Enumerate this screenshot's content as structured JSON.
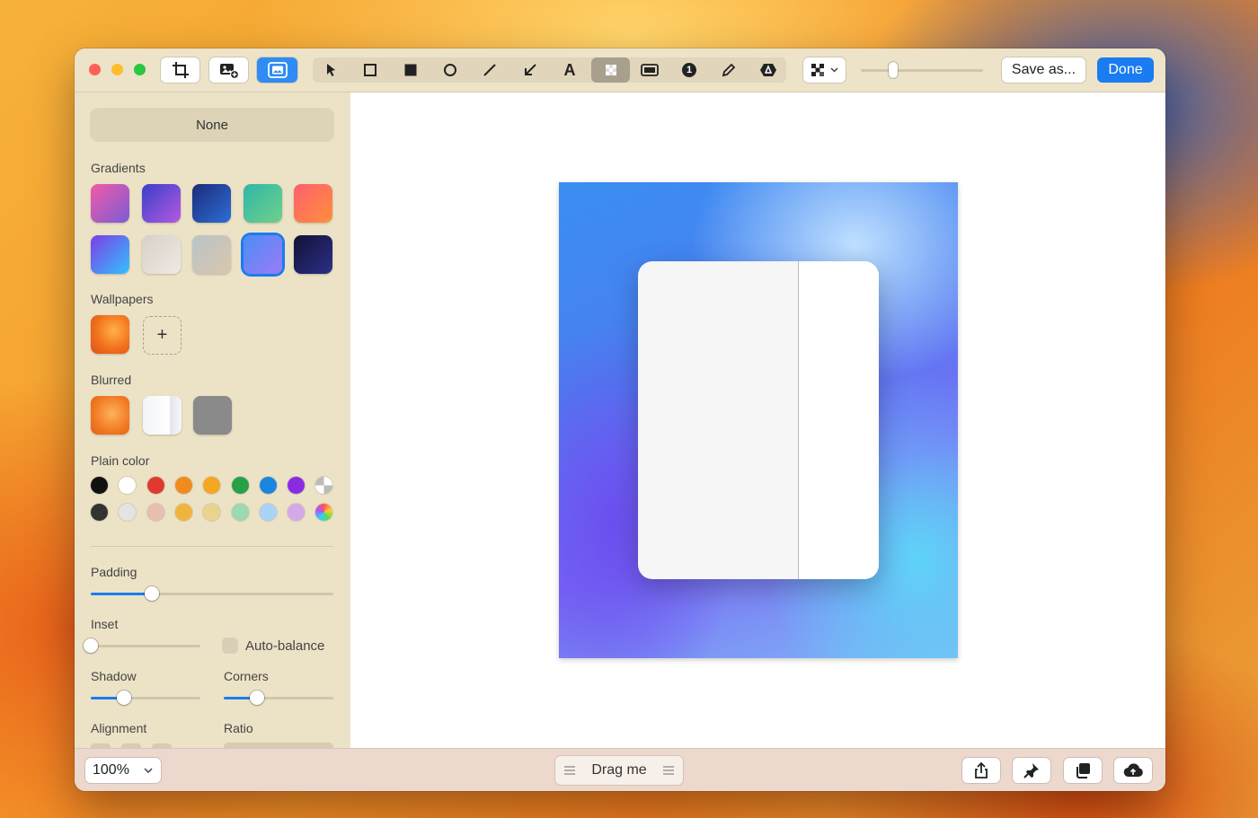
{
  "window": {
    "traffic_lights": [
      {
        "name": "close",
        "color": "#fe5f57"
      },
      {
        "name": "minimize",
        "color": "#febc2e"
      },
      {
        "name": "zoom",
        "color": "#28c840"
      }
    ]
  },
  "toolbar": {
    "left_buttons": [
      "crop-icon",
      "add-image-icon",
      "background-icon"
    ],
    "active_left_button": "background-icon",
    "tools": [
      "pointer-icon",
      "rectangle-outline-icon",
      "rectangle-filled-icon",
      "circle-icon",
      "line-icon",
      "arrow-icon",
      "text-icon",
      "pixelate-icon",
      "highlight-icon",
      "counter-icon",
      "pencil-icon",
      "redact-icon"
    ],
    "active_tool": "pixelate-icon",
    "counter_glyph": "1",
    "text_glyph": "A",
    "save_label": "Save as...",
    "done_label": "Done",
    "accent_color": "#1a7cf0"
  },
  "sidebar": {
    "none_label": "None",
    "gradients_label": "Gradients",
    "gradients": [
      {
        "colors": [
          "#f25aa6",
          "#7b5cd6"
        ]
      },
      {
        "colors": [
          "#3a3fc9",
          "#b35ae0"
        ]
      },
      {
        "colors": [
          "#1c2a7a",
          "#2c6fd6"
        ]
      },
      {
        "colors": [
          "#2fb7a8",
          "#6fd08a"
        ]
      },
      {
        "colors": [
          "#ff5f6d",
          "#ff8f3c"
        ]
      },
      {
        "colors": [
          "#7b3fe4",
          "#33c1ff"
        ]
      },
      {
        "colors": [
          "#d8d0c8",
          "#efe9e3"
        ]
      },
      {
        "colors": [
          "#b9c4c8",
          "#d9c6ad"
        ]
      },
      {
        "colors": [
          "#4c8df5",
          "#9b7bf7"
        ],
        "selected": true
      },
      {
        "colors": [
          "#121233",
          "#2c2f8a"
        ]
      }
    ],
    "wallpapers_label": "Wallpapers",
    "add_symbol": "+",
    "blurred_label": "Blurred",
    "plain_color_label": "Plain color",
    "plain_colors_row1": [
      "#111111",
      "#ffffff",
      "#e03a2e",
      "#f28b1f",
      "#f5a623",
      "#27a046",
      "#1a86e0",
      "#8a2be2",
      "multicolor-white"
    ],
    "plain_colors_row2": [
      "#333333",
      "#e4e4e4",
      "#e6bfb1",
      "#f0b43c",
      "#e9d38e",
      "#9bd9b0",
      "#a9d4f7",
      "#d5a9e8",
      "rainbow"
    ],
    "padding_label": "Padding",
    "padding_value": 0.25,
    "inset_label": "Inset",
    "inset_value": 0.0,
    "auto_balance_label": "Auto-balance",
    "shadow_label": "Shadow",
    "shadow_value": 0.3,
    "corners_label": "Corners",
    "corners_value": 0.3,
    "alignment_label": "Alignment",
    "ratio_label": "Ratio"
  },
  "bottombar": {
    "zoom_value": "100%",
    "drag_label": "Drag me",
    "actions": [
      "share-icon",
      "pin-icon",
      "copy-icon",
      "cloud-upload-icon"
    ]
  }
}
